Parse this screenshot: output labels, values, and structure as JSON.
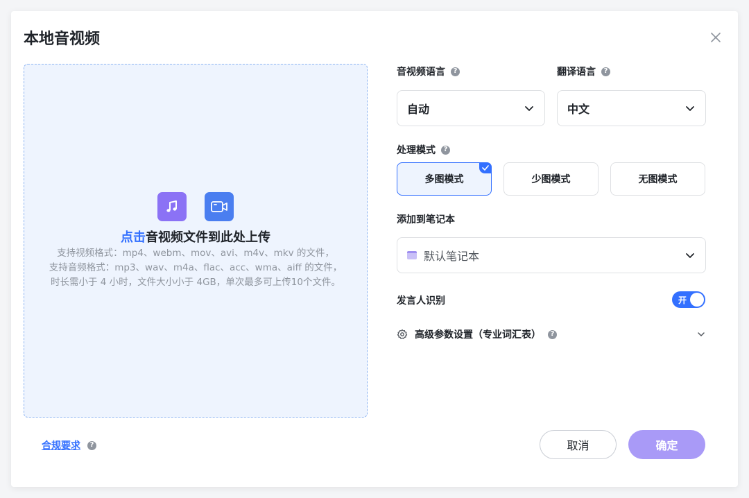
{
  "dialog": {
    "title": "本地音视频"
  },
  "upload": {
    "click_text": "点击",
    "main_text": "音视频文件到此处上传",
    "desc_lines": [
      "支持视频格式：mp4、webm、mov、avi、m4v、mkv 的文件，",
      "支持音频格式：mp3、wav、m4a、flac、acc、wma、aiff 的文件，",
      "时长需小于 4 小时，文件大小小于 4GB，单次最多可上传10个文件。"
    ]
  },
  "fields": {
    "audio_language": {
      "label": "音视频语言",
      "value": "自动"
    },
    "translate_language": {
      "label": "翻译语言",
      "value": "中文"
    },
    "mode": {
      "label": "处理模式",
      "options": [
        "多图模式",
        "少图模式",
        "无图模式"
      ],
      "selected": 0
    },
    "notebook": {
      "label": "添加到笔记本",
      "value": "默认笔记本"
    },
    "speaker": {
      "label": "发言人识别",
      "toggle_text": "开",
      "enabled": true
    },
    "advanced": {
      "label": "高级参数设置（专业词汇表）"
    }
  },
  "footer": {
    "compliance_link": "合规要求",
    "cancel_label": "取消",
    "ok_label": "确定"
  },
  "help_glyph": "?",
  "colors": {
    "accent": "#3370ff",
    "confirm_disabled": "#a99af7",
    "music_icon_bg": "#8b72f5",
    "video_icon_bg": "#4a7ef0"
  }
}
